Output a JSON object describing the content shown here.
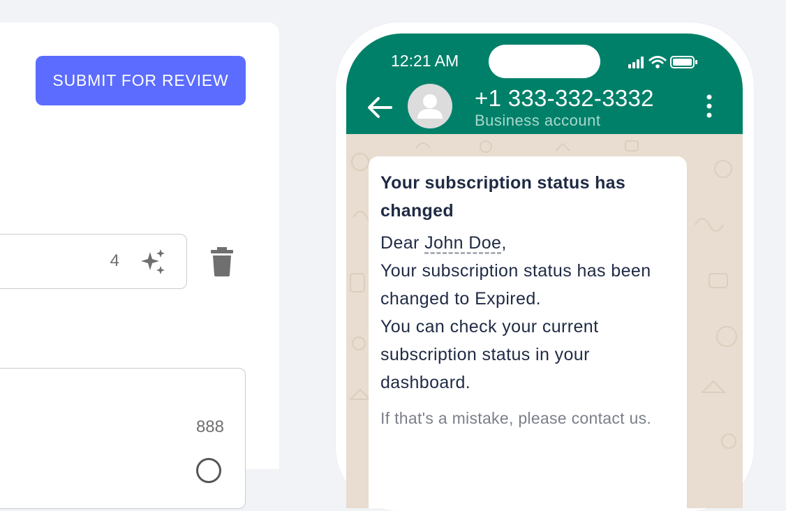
{
  "editor": {
    "submit_label": "SUBMIT FOR REVIEW",
    "variable_field_count": "4",
    "body_field_count": "888"
  },
  "phone": {
    "status_time": "12:21 AM",
    "contact_name": "+1 333-332-3332",
    "contact_subtitle": "Business account",
    "message": {
      "title": "Your subscription status has changed",
      "greeting_prefix": "Dear ",
      "variable_name": "John Doe",
      "greeting_suffix": ",",
      "line1": "Your subscription status has been changed to Expired.",
      "line2": "You can check your current subscription status in your dashboard.",
      "footer": "If that's a mistake, please contact us."
    }
  },
  "colors": {
    "primary_button": "#5b6cff",
    "whatsapp_header": "#008069",
    "chat_background": "#e8ddd0",
    "text_dark": "#1f2a44"
  },
  "icons": {
    "ai": "sparkles-icon",
    "delete": "trash-icon",
    "back": "back-arrow-icon",
    "avatar": "avatar-icon",
    "menu": "more-vertical-icon",
    "signal": "cellular-signal-icon",
    "wifi": "wifi-icon",
    "battery": "battery-icon"
  }
}
